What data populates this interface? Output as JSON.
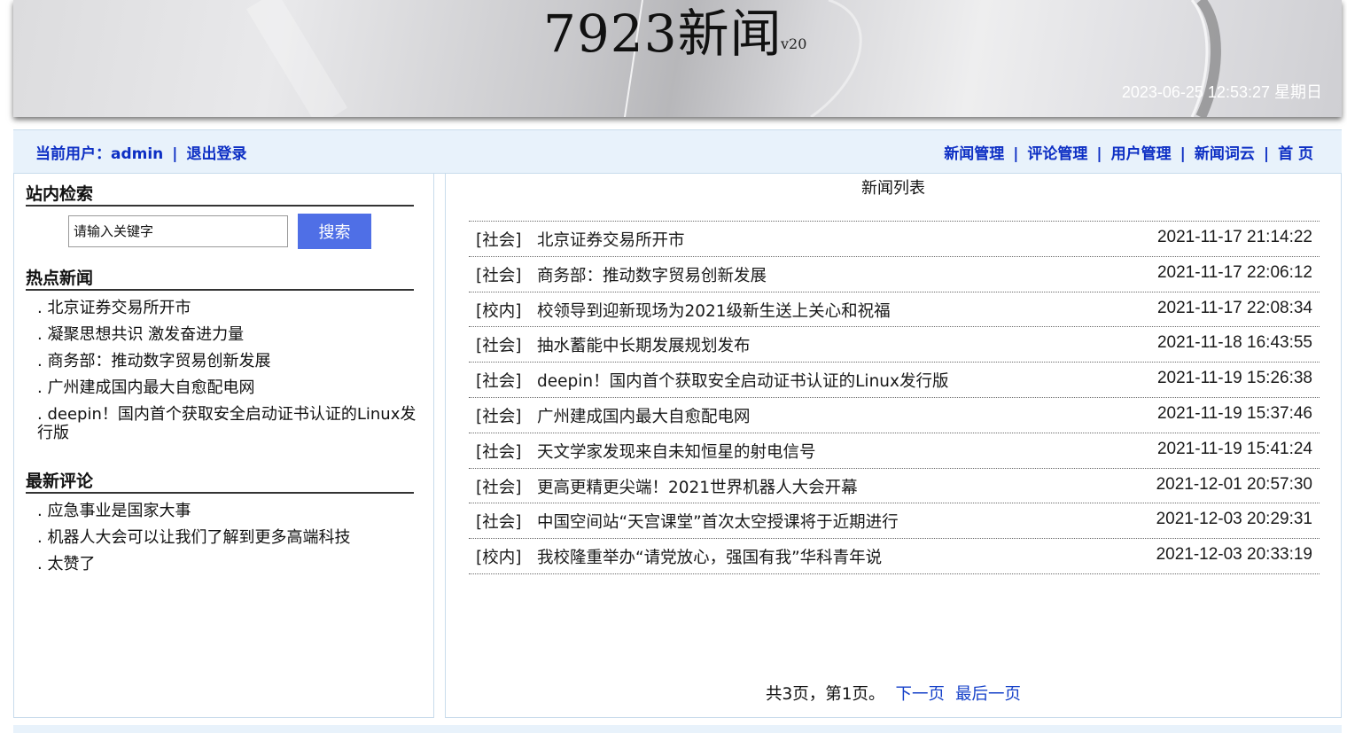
{
  "header": {
    "site_title": "7923新闻",
    "version": "v20",
    "datetime": "2023-06-25 12:53:27 星期日"
  },
  "nav": {
    "current_user_label": "当前用户：",
    "username": "admin",
    "logout_label": "退出登录",
    "links": [
      "新闻管理",
      "评论管理",
      "用户管理",
      "新闻词云",
      "首 页"
    ]
  },
  "sidebar": {
    "search": {
      "heading": "站内检索",
      "placeholder": "请输入关键字",
      "button_label": "搜索"
    },
    "hot_news": {
      "heading": "热点新闻",
      "items": [
        ". 北京证券交易所开市",
        ". 凝聚思想共识 激发奋进力量",
        ". 商务部：推动数字贸易创新发展",
        ". 广州建成国内最大自愈配电网",
        ". deepin！国内首个获取安全启动证书认证的Linux发行版"
      ]
    },
    "latest_comments": {
      "heading": "最新评论",
      "items": [
        ". 应急事业是国家大事",
        ". 机器人大会可以让我们了解到更多高端科技",
        ". 太赞了"
      ]
    }
  },
  "main": {
    "title": "新闻列表",
    "rows": [
      {
        "category": "[社会]",
        "title": "北京证券交易所开市",
        "time": "2021-11-17 21:14:22"
      },
      {
        "category": "[社会]",
        "title": "商务部：推动数字贸易创新发展",
        "time": "2021-11-17 22:06:12"
      },
      {
        "category": "[校内]",
        "title": "校领导到迎新现场为2021级新生送上关心和祝福",
        "time": "2021-11-17 22:08:34"
      },
      {
        "category": "[社会]",
        "title": "抽水蓄能中长期发展规划发布",
        "time": "2021-11-18 16:43:55"
      },
      {
        "category": "[社会]",
        "title": "deepin！国内首个获取安全启动证书认证的Linux发行版",
        "time": "2021-11-19 15:26:38"
      },
      {
        "category": "[社会]",
        "title": "广州建成国内最大自愈配电网",
        "time": "2021-11-19 15:37:46"
      },
      {
        "category": "[社会]",
        "title": "天文学家发现来自未知恒星的射电信号",
        "time": "2021-11-19 15:41:24"
      },
      {
        "category": "[社会]",
        "title": "更高更精更尖端！2021世界机器人大会开幕",
        "time": "2021-12-01 20:57:30"
      },
      {
        "category": "[社会]",
        "title": "中国空间站“天宫课堂”首次太空授课将于近期进行",
        "time": "2021-12-03 20:29:31"
      },
      {
        "category": "[校内]",
        "title": "我校隆重举办“请党放心，强国有我”华科青年说",
        "time": "2021-12-03 20:33:19"
      }
    ],
    "pager": {
      "summary": "共3页，第1页。",
      "next_label": "下一页",
      "last_label": "最后一页"
    }
  },
  "colors": {
    "nav_text": "#0d2fc4",
    "nav_background": "#e8f2fb",
    "search_button": "#4f6fe6",
    "pager_link": "#1540c9"
  }
}
